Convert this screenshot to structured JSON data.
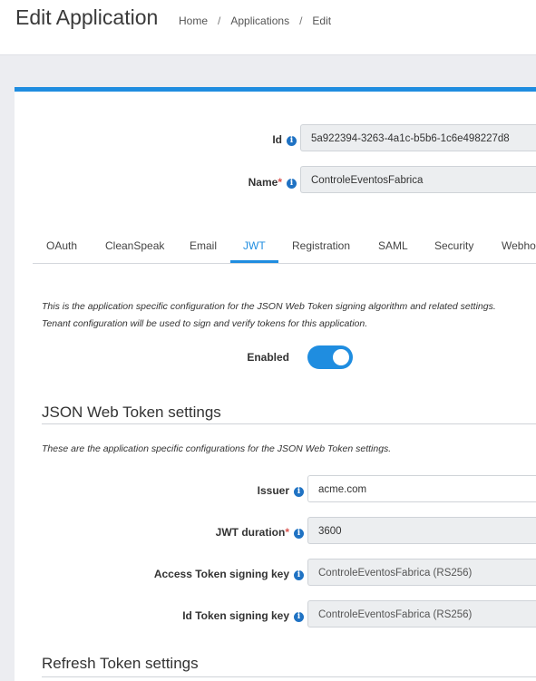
{
  "header": {
    "title": "Edit Application",
    "breadcrumb": [
      "Home",
      "Applications",
      "Edit"
    ],
    "separator": "/"
  },
  "form": {
    "id": {
      "label": "Id",
      "value": "5a922394-3263-4a1c-b5b6-1c6e498227d8"
    },
    "name": {
      "label": "Name",
      "required_mark": "*",
      "value": "ControleEventosFabrica"
    }
  },
  "tabs": [
    "OAuth",
    "CleanSpeak",
    "Email",
    "JWT",
    "Registration",
    "SAML",
    "Security",
    "Webhooks"
  ],
  "active_tab": "JWT",
  "jwt": {
    "description_line1": "This is the application specific configuration for the JSON Web Token signing algorithm and related settings.",
    "description_line2": "Tenant configuration will be used to sign and verify tokens for this application.",
    "enabled_label": "Enabled",
    "enabled": true
  },
  "jwt_settings": {
    "heading": "JSON Web Token settings",
    "description": "These are the application specific configurations for the JSON Web Token settings.",
    "issuer": {
      "label": "Issuer",
      "value": "acme.com"
    },
    "duration": {
      "label": "JWT duration",
      "required_mark": "*",
      "value": "3600"
    },
    "access_key": {
      "label": "Access Token signing key",
      "value": "ControleEventosFabrica (RS256)"
    },
    "id_key": {
      "label": "Id Token signing key",
      "value": "ControleEventosFabrica (RS256)"
    }
  },
  "refresh_settings": {
    "heading": "Refresh Token settings"
  },
  "colors": {
    "accent": "#1f8de0",
    "required": "#d9534f",
    "info_icon": "#1f72c3"
  }
}
